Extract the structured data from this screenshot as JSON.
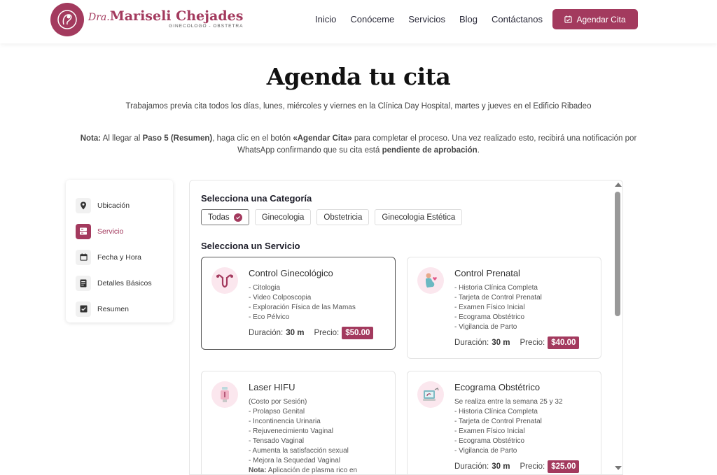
{
  "header": {
    "logo_prefix": "Dra.",
    "logo_name": "Mariseli Chejades",
    "logo_subtitle": "GINECOLOGO - OBSTETRA",
    "nav": [
      "Inicio",
      "Conóceme",
      "Servicios",
      "Blog",
      "Contáctanos"
    ],
    "cta_label": "Agendar Cita"
  },
  "page": {
    "title": "Agenda tu cita",
    "subtitle": "Trabajamos previa cita todos los días, lunes, miércoles y viernes en la Clínica Day Hospital, martes y jueves en el Edificio Ribadeo",
    "note_label": "Nota:",
    "note_text_1": " Al llegar al ",
    "note_step": "Paso 5 (Resumen)",
    "note_text_2": ", haga clic en el botón ",
    "note_button": "«Agendar Cita»",
    "note_text_3": " para completar el proceso. Una vez realizado esto, recibirá una notificación por WhatsApp confirmando que su cita está ",
    "note_status": "pendiente de aprobación",
    "note_end": "."
  },
  "steps": [
    {
      "label": "Ubicación",
      "icon": "location-pin-icon",
      "active": false
    },
    {
      "label": "Servicio",
      "icon": "server-icon",
      "active": true
    },
    {
      "label": "Fecha y Hora",
      "icon": "calendar-icon",
      "active": false
    },
    {
      "label": "Detalles Básicos",
      "icon": "document-icon",
      "active": false
    },
    {
      "label": "Resumen",
      "icon": "checkbox-icon",
      "active": false
    }
  ],
  "main": {
    "category_title": "Selecciona una Categoría",
    "categories": [
      "Todas",
      "Ginecologia",
      "Obstetricia",
      "Ginecologia Estética"
    ],
    "service_title": "Selecciona un Servicio",
    "duration_label": "Duración:",
    "price_label": "Precio:"
  },
  "services": [
    {
      "title": "Control Ginecológico",
      "items": [
        "- Citologia",
        "- Video Colposcopia",
        "- Exploración Física de las Mamas",
        "- Eco Pélvico"
      ],
      "duration": "30 m",
      "price": "$50.00"
    },
    {
      "title": "Control Prenatal",
      "items": [
        "- Historia Clínica Completa",
        "- Tarjeta de Control Prenatal",
        "- Examen Físico Inicial",
        "- Ecograma Obstétrico",
        "- Vigilancia de Parto"
      ],
      "duration": "30 m",
      "price": "$40.00"
    },
    {
      "title": "Laser HIFU",
      "items": [
        "(Costo por Sesión)",
        "- Prolapso Genital",
        "- Incontinencia Urinaria",
        "- Rejuvenecimiento Vaginal",
        "- Tensado Vaginal",
        "- Aumenta la satisfacción sexual",
        "- Mejora la Sequedad Vaginal"
      ],
      "note_label": "Nota:",
      "note": " Aplicación de plasma rico en"
    },
    {
      "title": "Ecograma Obstétrico",
      "items": [
        "Se realiza entre la semana 25 y 32",
        "- Historia Clínica Completa",
        "- Tarjeta de Control Prenatal",
        "- Examen Físico Inicial",
        "- Ecograma Obstétrico",
        "- Vigilancia de Parto"
      ],
      "duration": "30 m",
      "price": "$25.00"
    }
  ],
  "colors": {
    "accent": "#a33a5e",
    "icon_bg": "#fbe7ee"
  }
}
